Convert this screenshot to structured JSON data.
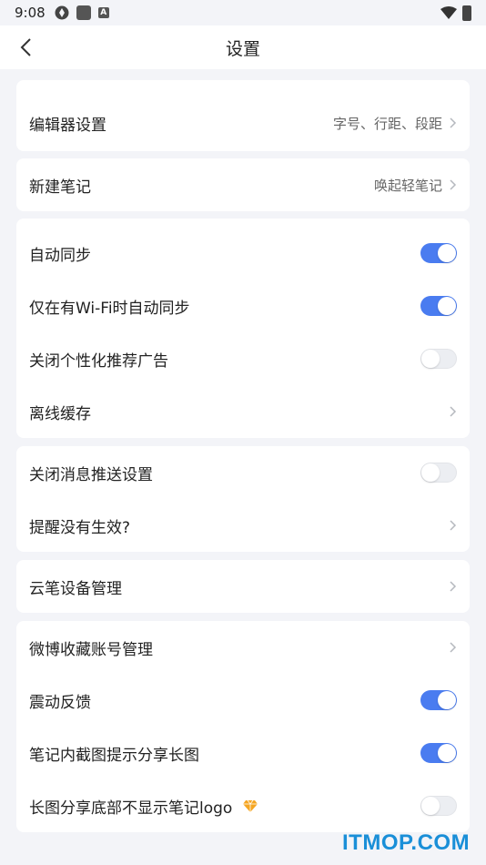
{
  "status": {
    "time": "9:08",
    "icon_a": "A"
  },
  "header": {
    "title": "设置"
  },
  "editor": {
    "label": "编辑器设置",
    "value": "字号、行距、段距"
  },
  "new_note": {
    "label": "新建笔记",
    "value": "唤起轻笔记"
  },
  "sync": {
    "auto_sync": {
      "label": "自动同步",
      "on": true
    },
    "wifi_sync": {
      "label": "仅在有Wi-Fi时自动同步",
      "on": true
    },
    "ads": {
      "label": "关闭个性化推荐广告",
      "on": false
    },
    "offline": {
      "label": "离线缓存"
    }
  },
  "notify": {
    "push": {
      "label": "关闭消息推送设置",
      "on": false
    },
    "reminder": {
      "label": "提醒没有生效?"
    }
  },
  "device": {
    "label": "云笔设备管理"
  },
  "misc": {
    "weibo": {
      "label": "微博收藏账号管理"
    },
    "vibration": {
      "label": "震动反馈",
      "on": true
    },
    "screenshot": {
      "label": "笔记内截图提示分享长图",
      "on": true
    },
    "logo": {
      "label": "长图分享底部不显示笔记logo",
      "on": false
    }
  },
  "watermark": "ITMOP.COM",
  "colors": {
    "accent": "#4a7cf0",
    "background": "#f3f4f8",
    "gem": "#f5a623"
  }
}
